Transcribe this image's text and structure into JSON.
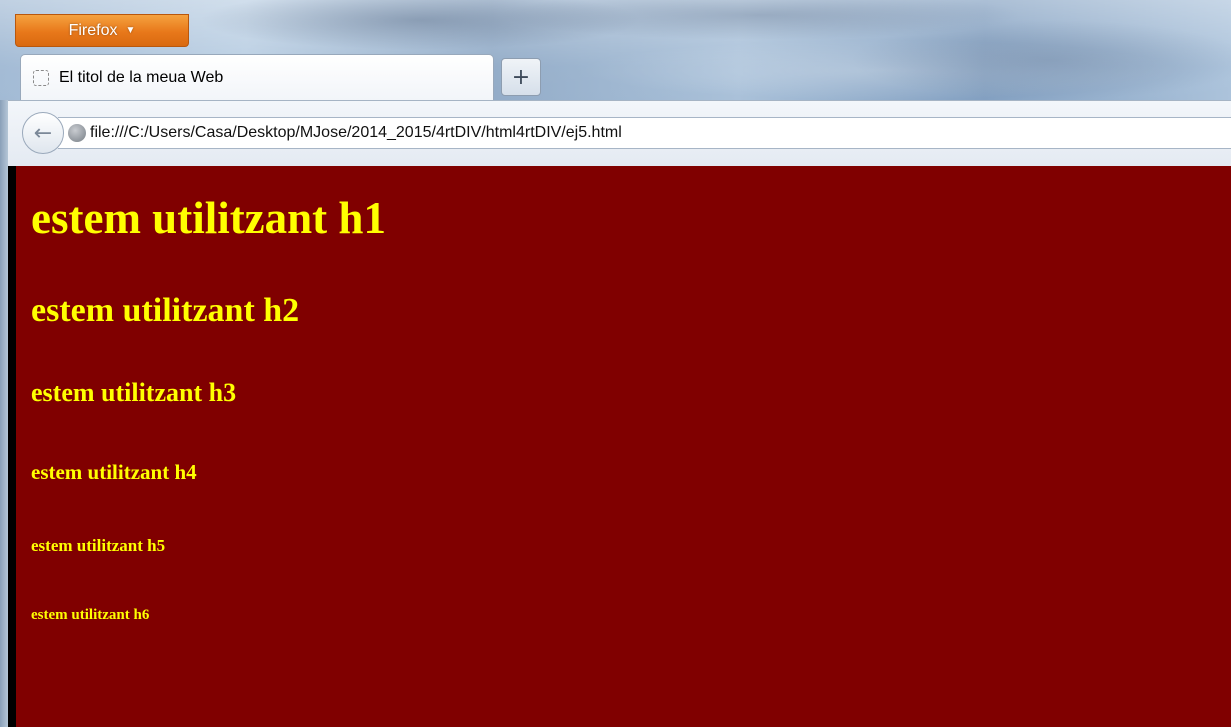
{
  "browser": {
    "menu_button_label": "Firefox",
    "menu_caret": "▼",
    "tab": {
      "title": "El titol de la meua Web"
    },
    "new_tab_label": "+",
    "back_arrow": "←",
    "url": "file:///C:/Users/Casa/Desktop/MJose/2014_2015/4rtDIV/html4rtDIV/ej5.html"
  },
  "page": {
    "background_color": "#800000",
    "text_color": "#ffff00",
    "headings": {
      "h1": "estem utilitzant h1",
      "h2": "estem utilitzant h2",
      "h3": "estem utilitzant h3",
      "h4": "estem utilitzant h4",
      "h5": "estem utilitzant h5",
      "h6": "estem utilitzant h6"
    }
  },
  "icons": {
    "tab_favicon": "blank-page-icon",
    "site_identity": "globe-icon",
    "back": "back-arrow-icon",
    "menu_dropdown": "chevron-down-icon"
  }
}
